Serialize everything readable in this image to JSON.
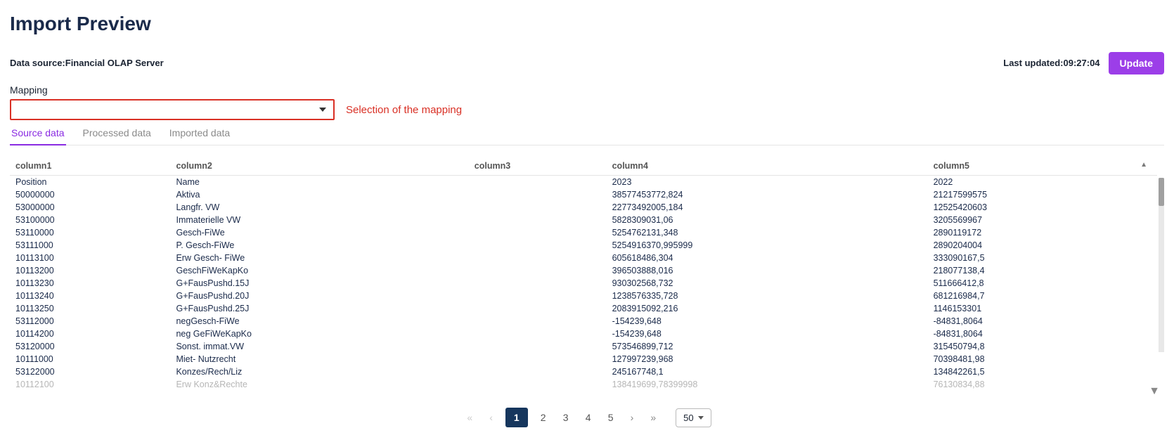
{
  "title": "Import Preview",
  "data_source_label": "Data source:",
  "data_source_value": "Financial OLAP Server",
  "last_updated_label": "Last updated:",
  "last_updated_value": "09:27:04",
  "update_button": "Update",
  "mapping_label": "Mapping",
  "annotation_text": "Selection of the mapping",
  "tabs": {
    "source": "Source data",
    "processed": "Processed data",
    "imported": "Imported data"
  },
  "columns": {
    "c1": "column1",
    "c2": "column2",
    "c3": "column3",
    "c4": "column4",
    "c5": "column5"
  },
  "rows": [
    {
      "c1": "Position",
      "c2": "Name",
      "c3": "",
      "c4": "2023",
      "c5": "2022"
    },
    {
      "c1": "50000000",
      "c2": "Aktiva",
      "c3": "",
      "c4": "38577453772,824",
      "c5": "21217599575"
    },
    {
      "c1": "53000000",
      "c2": "Langfr. VW",
      "c3": "",
      "c4": "22773492005,184",
      "c5": "12525420603"
    },
    {
      "c1": "53100000",
      "c2": "Immaterielle VW",
      "c3": "",
      "c4": "5828309031,06",
      "c5": "3205569967"
    },
    {
      "c1": "53110000",
      "c2": "Gesch-FiWe",
      "c3": "",
      "c4": "5254762131,348",
      "c5": "2890119172"
    },
    {
      "c1": "53111000",
      "c2": "P. Gesch-FiWe",
      "c3": "",
      "c4": "5254916370,995999",
      "c5": "2890204004"
    },
    {
      "c1": "10113100",
      "c2": "Erw Gesch- FiWe",
      "c3": "",
      "c4": "605618486,304",
      "c5": "333090167,5"
    },
    {
      "c1": "10113200",
      "c2": "GeschFiWeKapKo",
      "c3": "",
      "c4": "396503888,016",
      "c5": "218077138,4"
    },
    {
      "c1": "10113230",
      "c2": "G+FausPushd.15J",
      "c3": "",
      "c4": "930302568,732",
      "c5": "511666412,8"
    },
    {
      "c1": "10113240",
      "c2": "G+FausPushd.20J",
      "c3": "",
      "c4": "1238576335,728",
      "c5": "681216984,7"
    },
    {
      "c1": "10113250",
      "c2": "G+FausPushd.25J",
      "c3": "",
      "c4": "2083915092,216",
      "c5": "1146153301"
    },
    {
      "c1": "53112000",
      "c2": "negGesch-FiWe",
      "c3": "",
      "c4": "-154239,648",
      "c5": "-84831,8064"
    },
    {
      "c1": "10114200",
      "c2": "neg GeFiWeKapKo",
      "c3": "",
      "c4": "-154239,648",
      "c5": "-84831,8064"
    },
    {
      "c1": "53120000",
      "c2": "Sonst. immat.VW",
      "c3": "",
      "c4": "573546899,712",
      "c5": "315450794,8"
    },
    {
      "c1": "10111000",
      "c2": "Miet- Nutzrecht",
      "c3": "",
      "c4": "127997239,968",
      "c5": "70398481,98"
    },
    {
      "c1": "53122000",
      "c2": "Konzes/Rech/Liz",
      "c3": "",
      "c4": "245167748,1",
      "c5": "134842261,5"
    }
  ],
  "fade_row": {
    "c1": "10112100",
    "c2": "Erw Konz&Rechte",
    "c3": "",
    "c4": "138419699,78399998",
    "c5": "76130834,88"
  },
  "pagination": {
    "pages": [
      "1",
      "2",
      "3",
      "4",
      "5"
    ],
    "size": "50"
  }
}
